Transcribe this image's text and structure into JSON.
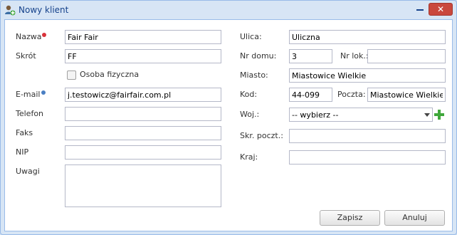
{
  "window": {
    "title": "Nowy klient"
  },
  "left": {
    "name_label": "Nazwa",
    "name_value": "Fair Fair",
    "short_label": "Skrót",
    "short_value": "FF",
    "person_label": "Osoba fizyczna",
    "email_label": "E-mail",
    "email_value": "j.testowicz@fairfair.com.pl",
    "phone_label": "Telefon",
    "phone_value": "",
    "fax_label": "Faks",
    "fax_value": "",
    "nip_label": "NIP",
    "nip_value": "",
    "notes_label": "Uwagi",
    "notes_value": ""
  },
  "right": {
    "street_label": "Ulica:",
    "street_value": "Uliczna",
    "house_label": "Nr domu:",
    "house_value": "3",
    "flat_label": "Nr lok.:",
    "flat_value": "",
    "city_label": "Miasto:",
    "city_value": "Miastowice Wielkie",
    "code_label": "Kod:",
    "code_value": "44-099",
    "post_label": "Poczta:",
    "post_value": "Miastowice Wielkie",
    "voiv_label": "Woj.:",
    "voiv_value": "-- wybierz --",
    "pobox_label": "Skr. poczt.:",
    "pobox_value": "",
    "country_label": "Kraj:",
    "country_value": ""
  },
  "buttons": {
    "save": "Zapisz",
    "cancel": "Anuluj"
  }
}
